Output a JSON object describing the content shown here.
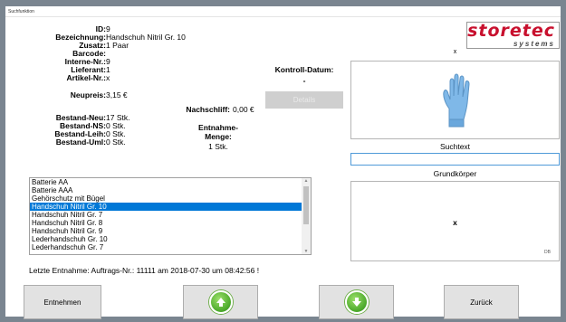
{
  "window": {
    "title": "Suchfunktion"
  },
  "article": {
    "id_label": "ID:",
    "id": "9",
    "bezeichnung_label": "Bezeichnung:",
    "bezeichnung": "Handschuh Nitril Gr. 10",
    "zusatz_label": "Zusatz:",
    "zusatz": "1 Paar",
    "barcode_label": "Barcode:",
    "barcode": "",
    "interne_nr_label": "Interne-Nr.:",
    "interne_nr": "9",
    "lieferant_label": "Lieferant:",
    "lieferant": "1",
    "artikel_nr_label": "Artikel-Nr.:",
    "artikel_nr": "x",
    "neupreis_label": "Neupreis:",
    "neupreis": "3,15 €",
    "nachschliff_label": "Nachschliff:",
    "nachschliff": "0,00 €",
    "bestand_neu_label": "Bestand-Neu:",
    "bestand_neu": "17 Stk.",
    "bestand_ns_label": "Bestand-NS:",
    "bestand_ns": "0 Stk.",
    "bestand_leih_label": "Bestand-Leih:",
    "bestand_leih": "0 Stk.",
    "bestand_uml_label": "Bestand-Uml:",
    "bestand_uml": "0 Stk.",
    "entnahme_menge_label_1": "Entnahme-",
    "entnahme_menge_label_2": "Menge:",
    "entnahme_menge": "1 Stk."
  },
  "kontrolle": {
    "label": "Kontroll-Datum:",
    "value": "-",
    "details_button": "Details"
  },
  "logo": {
    "text_main": "storetec",
    "text_sub": "systems"
  },
  "image_panel": {
    "caption": "x"
  },
  "search": {
    "label": "Suchtext",
    "value": "",
    "placeholder": ""
  },
  "grundkoerper": {
    "label": "Grundkörper",
    "value": "x",
    "tag": "DB"
  },
  "list": {
    "items": [
      "Batterie AA",
      "Batterie AAA",
      "Gehörschutz mit Bügel",
      "Handschuh Nitril Gr. 10",
      "Handschuh Nitril Gr. 7",
      "Handschuh Nitril Gr. 8",
      "Handschuh Nitril Gr. 9",
      "Lederhandschuh Gr. 10",
      "Lederhandschuh Gr. 7"
    ],
    "selected_index": 3
  },
  "status": {
    "last_withdrawal": "Letzte Entnahme: Auftrags-Nr.: 11111 am 2018-07-30 um 08:42:56 !"
  },
  "buttons": {
    "entnehmen": "Entnehmen",
    "zurueck": "Zurück",
    "up_icon": "arrow-up-icon",
    "down_icon": "arrow-down-icon"
  },
  "colors": {
    "logo_red": "#c8102e",
    "selection_blue": "#0078d7",
    "search_border": "#4f9ad8",
    "arrow_green": "#4aa82a"
  }
}
